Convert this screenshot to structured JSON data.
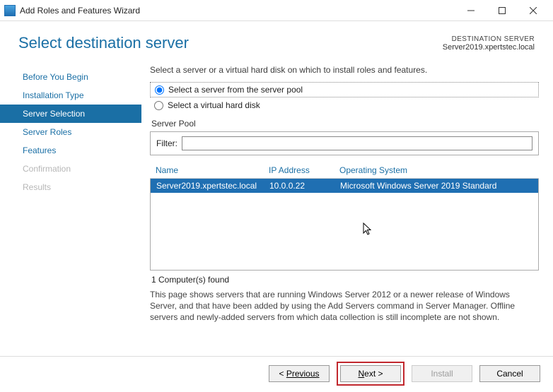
{
  "window": {
    "title": "Add Roles and Features Wizard"
  },
  "header": {
    "title": "Select destination server",
    "dest_label": "DESTINATION SERVER",
    "dest_name": "Server2019.xpertstec.local"
  },
  "sidebar": {
    "items": [
      {
        "label": "Before You Begin",
        "state": "link"
      },
      {
        "label": "Installation Type",
        "state": "link"
      },
      {
        "label": "Server Selection",
        "state": "active"
      },
      {
        "label": "Server Roles",
        "state": "link"
      },
      {
        "label": "Features",
        "state": "link"
      },
      {
        "label": "Confirmation",
        "state": "disabled"
      },
      {
        "label": "Results",
        "state": "disabled"
      }
    ]
  },
  "main": {
    "instruction": "Select a server or a virtual hard disk on which to install roles and features.",
    "radio_pool": "Select a server from the server pool",
    "radio_vhd": "Select a virtual hard disk",
    "pool_label": "Server Pool",
    "filter_label": "Filter:",
    "filter_value": "",
    "columns": {
      "name": "Name",
      "ip": "IP Address",
      "os": "Operating System"
    },
    "rows": [
      {
        "name": "Server2019.xpertstec.local",
        "ip": "10.0.0.22",
        "os": "Microsoft Windows Server 2019 Standard"
      }
    ],
    "count_text": "1 Computer(s) found",
    "note": "This page shows servers that are running Windows Server 2012 or a newer release of Windows Server, and that have been added by using the Add Servers command in Server Manager. Offline servers and newly-added servers from which data collection is still incomplete are not shown."
  },
  "footer": {
    "previous": "Previous",
    "next": "Next >",
    "install": "Install",
    "cancel": "Cancel"
  }
}
